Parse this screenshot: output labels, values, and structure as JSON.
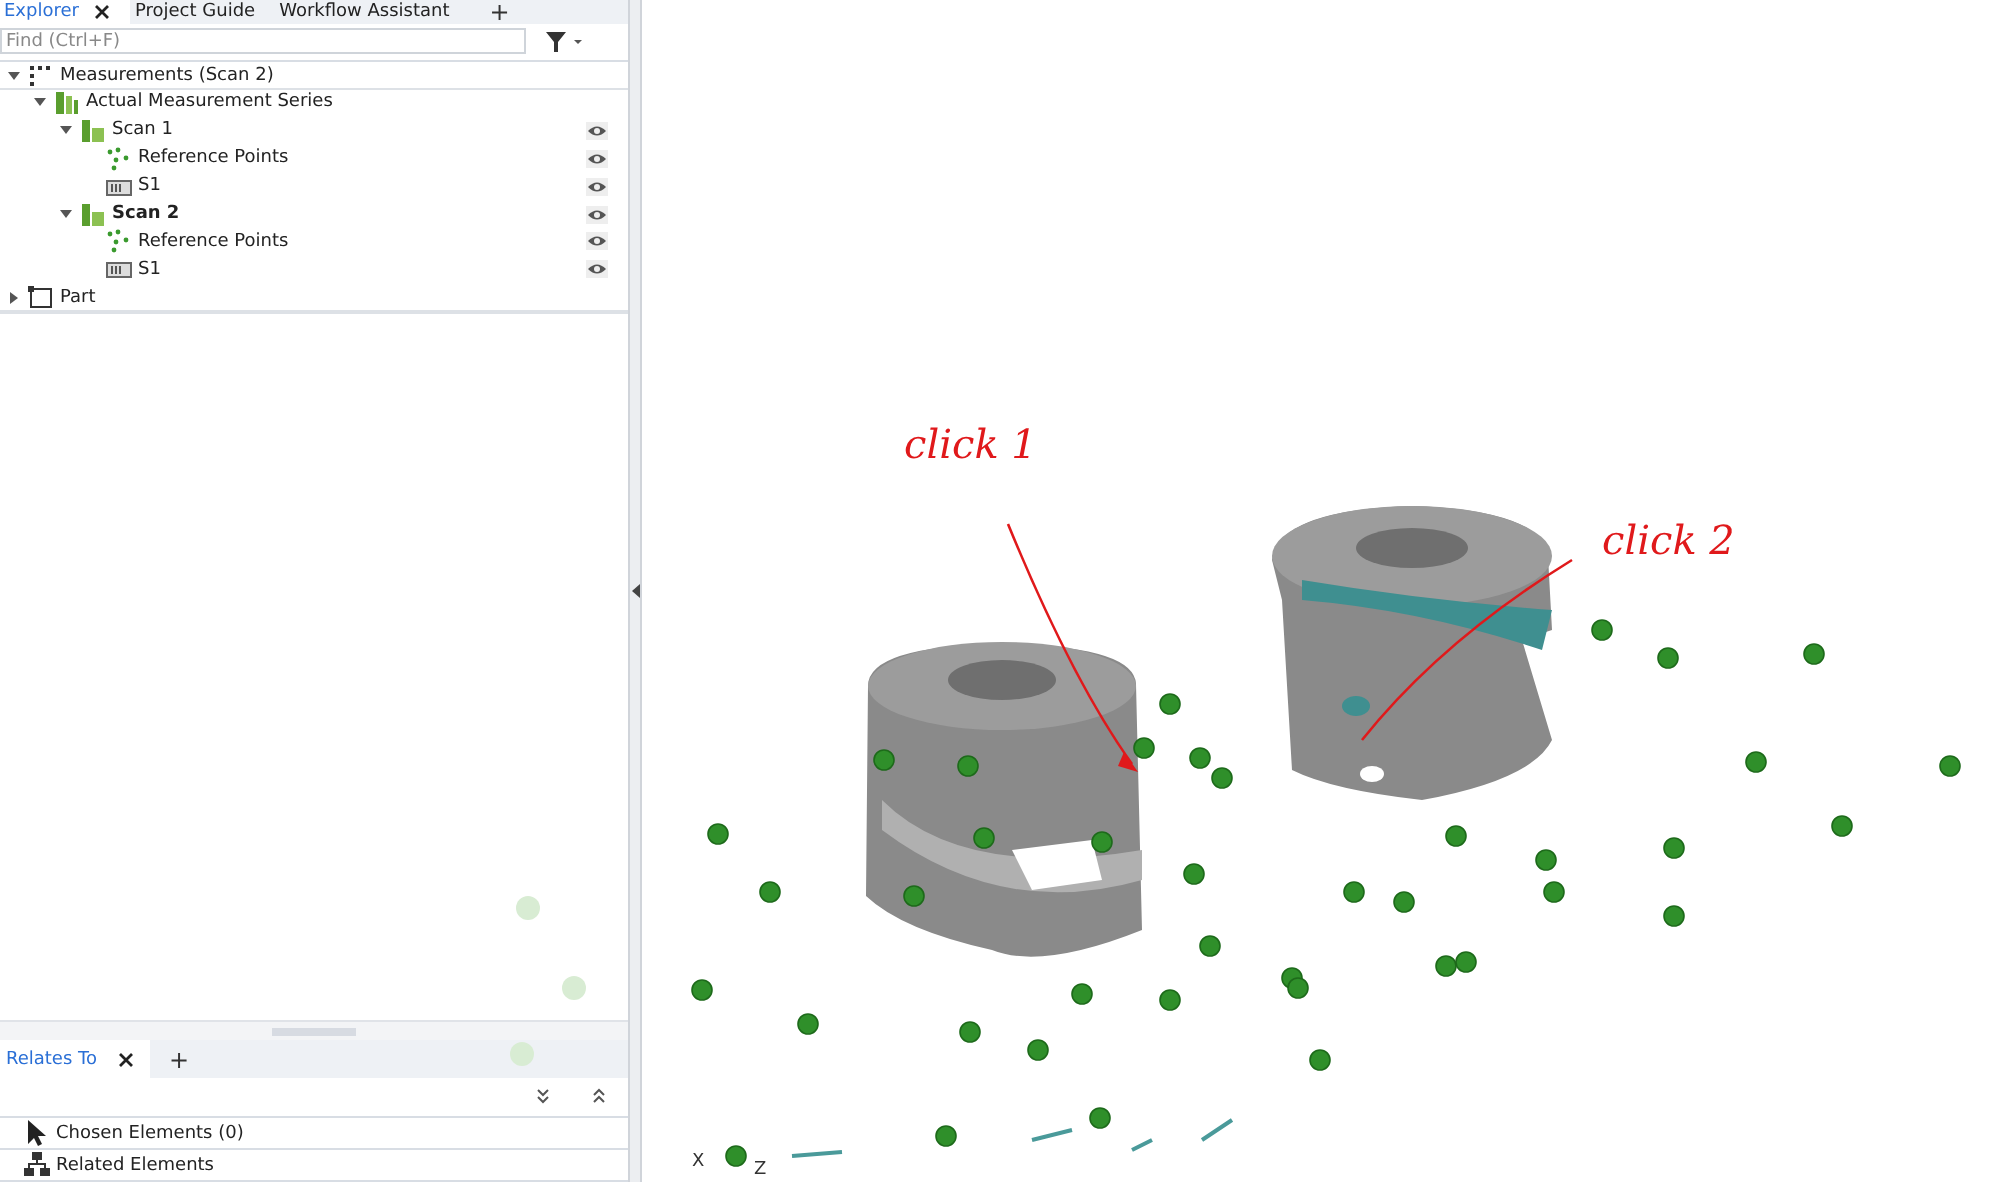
{
  "explorer_tabs": [
    {
      "label": "Explorer",
      "selected": true,
      "closable": true
    },
    {
      "label": "Project Guide",
      "selected": false,
      "closable": false
    },
    {
      "label": "Workflow Assistant",
      "selected": false,
      "closable": false
    }
  ],
  "add_tab": "+",
  "search": {
    "placeholder": "Find (Ctrl+F)"
  },
  "tree": [
    {
      "label": "Measurements (Scan 2)",
      "kind": "measurements",
      "expanded": true,
      "bold": false,
      "visible_toggle": false,
      "children": [
        {
          "label": "Actual Measurement Series",
          "kind": "series",
          "expanded": true,
          "bold": false,
          "visible_toggle": false,
          "children": [
            {
              "label": "Scan 1",
              "kind": "scan",
              "expanded": true,
              "bold": false,
              "visible_toggle": true,
              "children": [
                {
                  "label": "Reference Points",
                  "kind": "points",
                  "bold": false,
                  "visible_toggle": true
                },
                {
                  "label": "S1",
                  "kind": "sensor",
                  "bold": false,
                  "visible_toggle": true
                }
              ]
            },
            {
              "label": "Scan 2",
              "kind": "scan",
              "expanded": true,
              "bold": true,
              "visible_toggle": true,
              "children": [
                {
                  "label": "Reference Points",
                  "kind": "points",
                  "bold": false,
                  "visible_toggle": true
                },
                {
                  "label": "S1",
                  "kind": "sensor",
                  "bold": false,
                  "visible_toggle": true
                }
              ]
            }
          ]
        }
      ]
    },
    {
      "label": "Part",
      "kind": "part",
      "expanded": false,
      "bold": false,
      "visible_toggle": false
    }
  ],
  "relates_tabs": [
    {
      "label": "Relates To",
      "selected": true,
      "closable": true
    }
  ],
  "relates_add_tab": "+",
  "relates_items": [
    {
      "label": "Chosen Elements (0)",
      "kind": "pointer"
    },
    {
      "label": "Related Elements",
      "kind": "hierarchy"
    }
  ],
  "viewport": {
    "annotations": [
      "click 1",
      "click 2"
    ],
    "axes": [
      "X",
      "Z"
    ]
  }
}
